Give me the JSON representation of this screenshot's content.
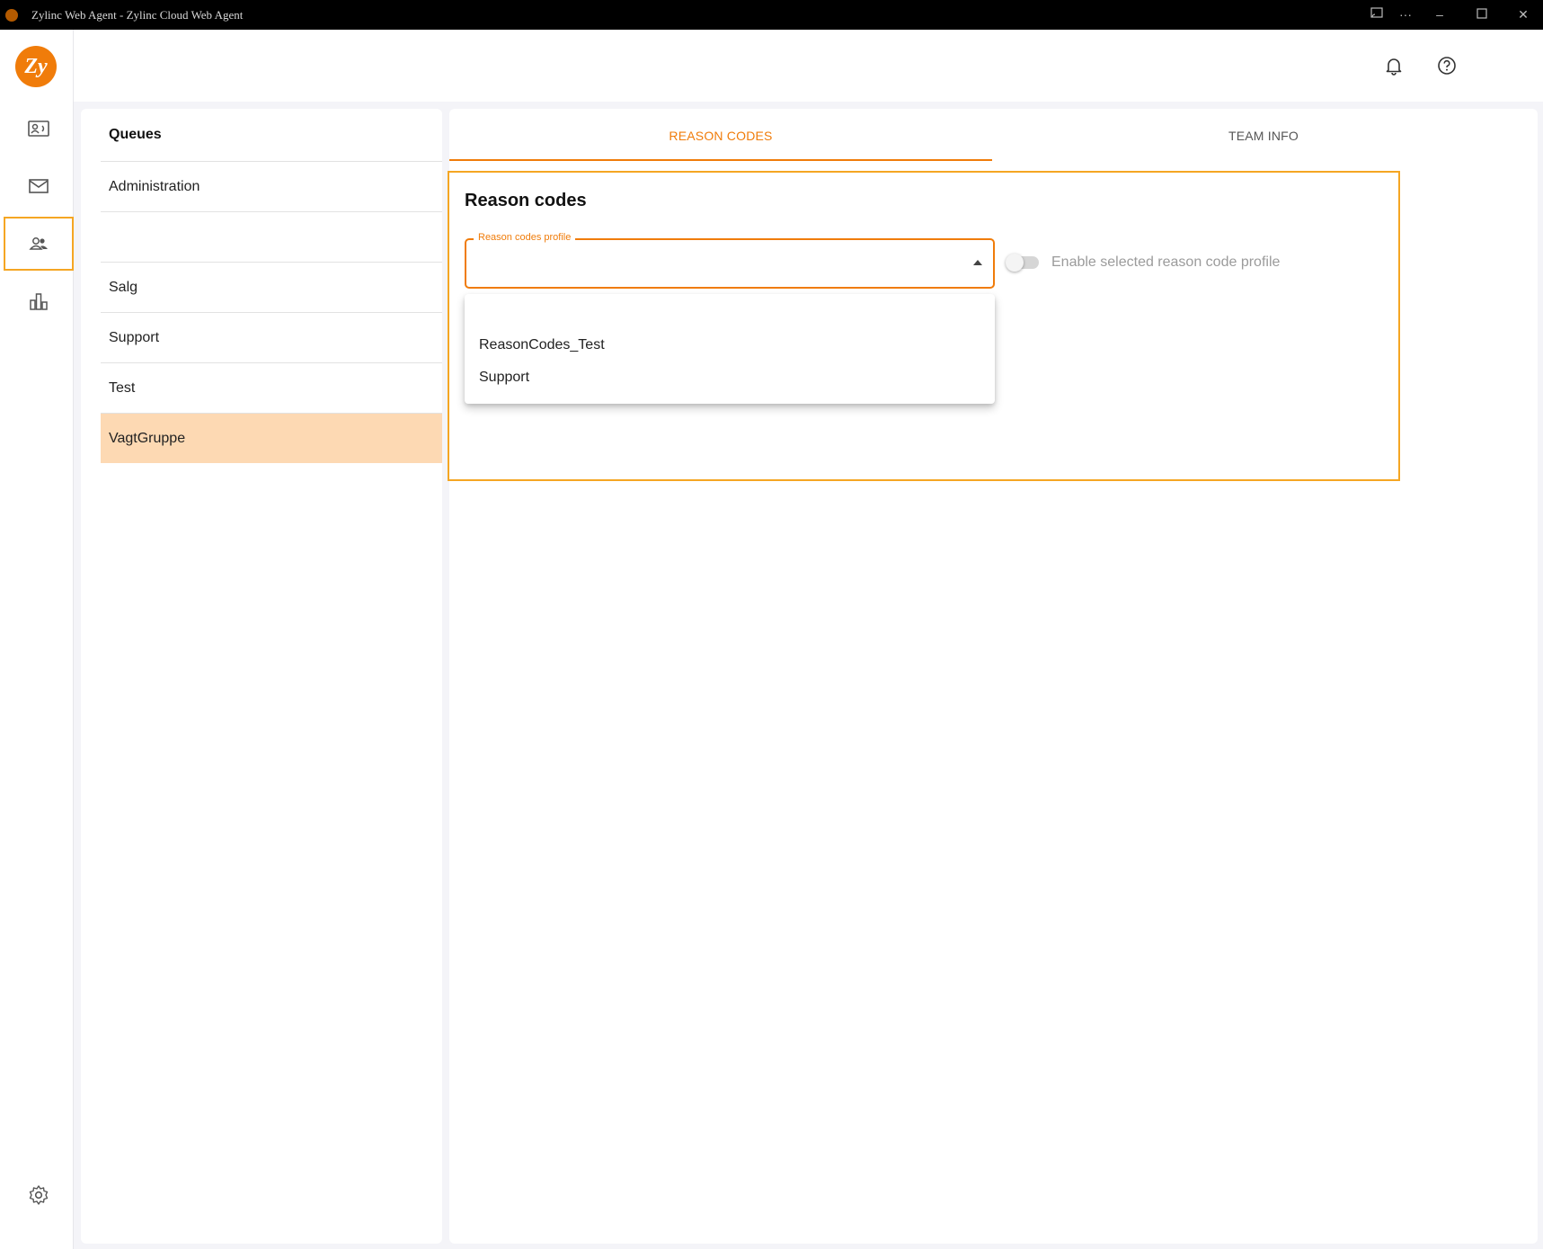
{
  "window": {
    "title": "Zylinc Web Agent - Zylinc Cloud Web Agent",
    "controls": [
      "cast-icon",
      "more-icon",
      "minimize-icon",
      "maximize-icon",
      "close-icon"
    ]
  },
  "logo": {
    "text": "Zy",
    "color": "#f07c0a"
  },
  "rail": {
    "items": [
      {
        "icon": "contact-card-icon"
      },
      {
        "icon": "mail-icon"
      },
      {
        "icon": "team-icon",
        "active": true
      },
      {
        "icon": "bar-chart-icon"
      }
    ],
    "settings_icon": "gear-icon"
  },
  "header": {
    "icons": [
      "bell-icon",
      "help-icon",
      "avatar"
    ]
  },
  "queues": {
    "title": "Queues",
    "items": [
      {
        "label": "Administration"
      },
      {
        "label": ""
      },
      {
        "label": "Salg"
      },
      {
        "label": "Support"
      },
      {
        "label": "Test"
      },
      {
        "label": "VagtGruppe",
        "selected": true
      }
    ]
  },
  "tabs": [
    {
      "label": "REASON CODES",
      "active": true
    },
    {
      "label": "TEAM INFO",
      "active": false
    }
  ],
  "reason_codes": {
    "heading": "Reason codes",
    "select": {
      "label": "Reason codes profile",
      "value": "",
      "open": true,
      "options": [
        "",
        "ReasonCodes_Test",
        "Support"
      ]
    },
    "toggle": {
      "label": "Enable selected reason code profile",
      "enabled": false
    }
  },
  "colors": {
    "accent": "#f07c0a",
    "highlight": "#f5a623",
    "selected_row": "#fdd9b3"
  }
}
